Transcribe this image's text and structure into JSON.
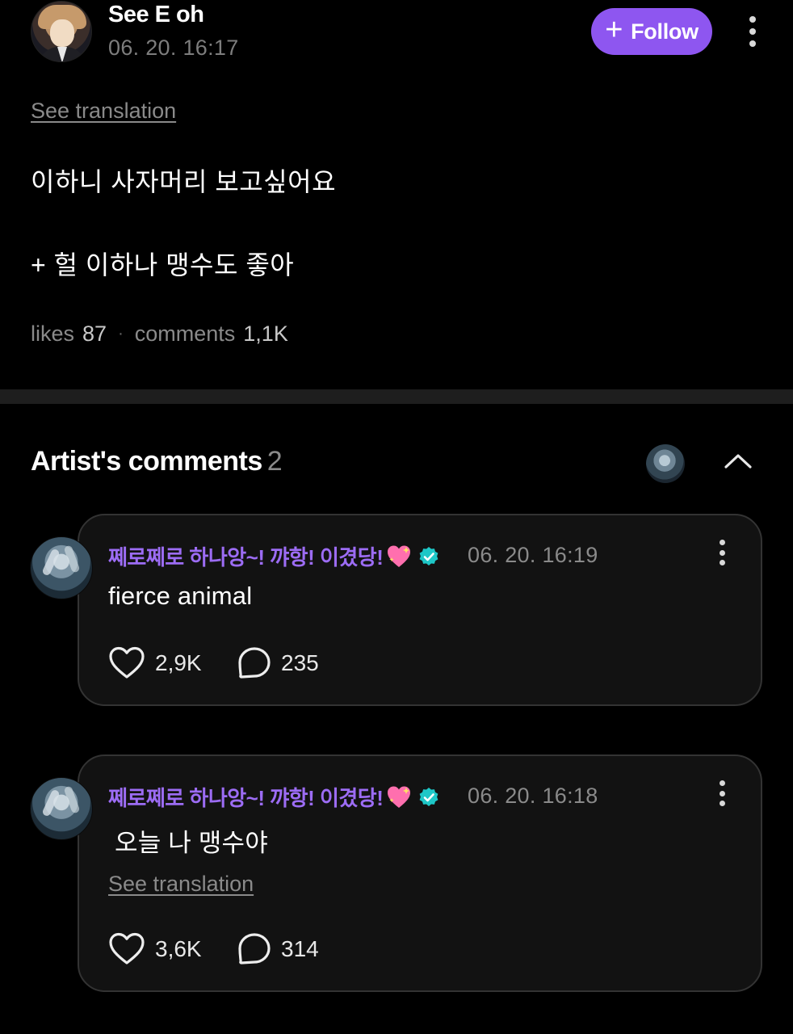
{
  "post": {
    "author": "See E oh",
    "timestamp": "06. 20. 16:17",
    "follow_label": "Follow",
    "see_translation": "See translation",
    "line1": "이하니 사자머리 보고싶어요",
    "line2": "+ 헐 이하나 맹수도 좋아",
    "likes_label": "likes",
    "likes_count": "87",
    "stats_separator": "·",
    "comments_label": "comments",
    "comments_count": "1,1K"
  },
  "artist_comments": {
    "title": "Artist's comments",
    "count": "2",
    "items": [
      {
        "author": "쩨로쩨로 하나앙~! 꺄항! 이겼당!",
        "timestamp": "06. 20. 16:19",
        "text": "fierce animal",
        "likes": "2,9K",
        "replies": "235"
      },
      {
        "author": "쩨로쩨로 하나앙~! 꺄항! 이겼당!",
        "timestamp": "06. 20. 16:18",
        "text": "오늘 나 맹수야",
        "see_translation": "See translation",
        "likes": "3,6K",
        "replies": "314"
      }
    ]
  },
  "icons": {
    "follow": "plus-icon",
    "more": "more-vertical-icon",
    "collapse": "chevron-up-icon",
    "verified": "verified-badge-icon",
    "emoji": "sparkling-heart-icon",
    "like": "heart-icon",
    "reply": "comment-bubble-icon"
  },
  "colors": {
    "background": "#000000",
    "accent": "#8e56f0",
    "artist_name": "#9c6cf4",
    "verified": "#1ec7c7",
    "card_bg": "#121212",
    "muted_text": "#8a8a8a"
  }
}
